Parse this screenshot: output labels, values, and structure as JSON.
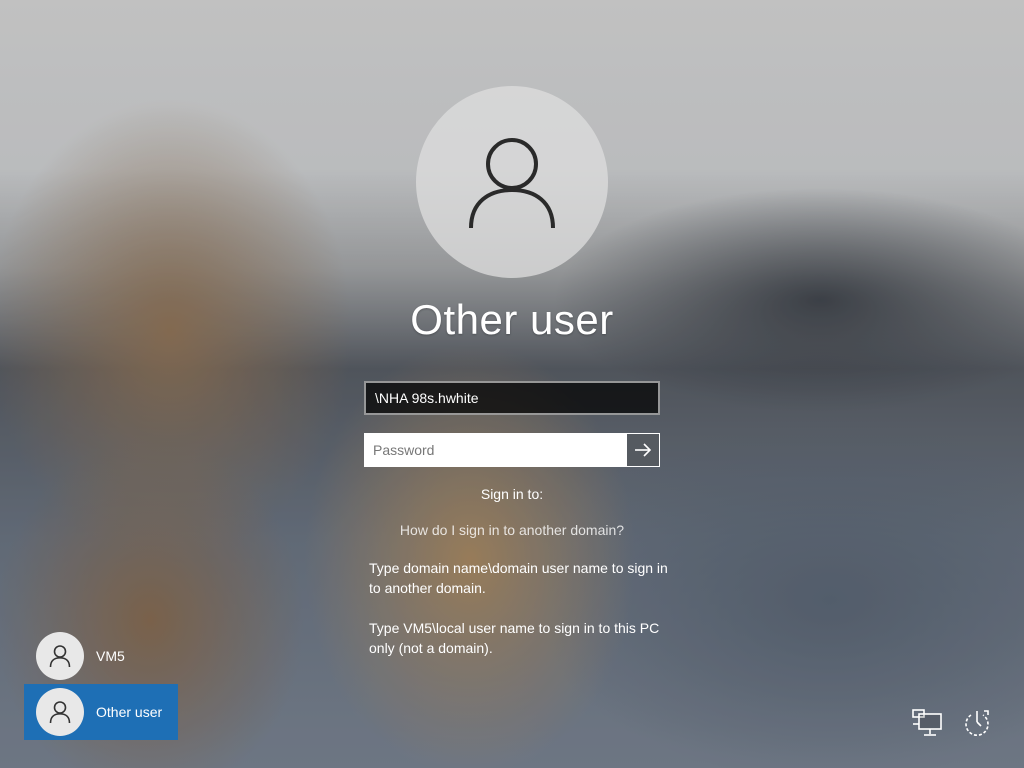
{
  "login": {
    "title": "Other user",
    "username_value": "\\NHA 98s.hwhite",
    "password_placeholder": "Password",
    "submit_icon": "arrow-right-icon",
    "sign_in_to_label": "Sign in to:",
    "domain_help_link": "How do I sign in to another domain?",
    "help_text_1": "Type domain name\\domain user name to sign in to another domain.",
    "help_text_2": "Type VM5\\local user name to sign in to this PC only (not a domain)."
  },
  "users": [
    {
      "name": "VM5",
      "icon": "user-icon",
      "selected": false
    },
    {
      "name": "Other user",
      "icon": "user-icon",
      "selected": true
    }
  ],
  "system_icons": [
    {
      "name": "network-icon"
    },
    {
      "name": "power-icon"
    }
  ],
  "colors": {
    "selected_tile": "#1e6fb5",
    "avatar_bg": "#e0e0e0"
  }
}
